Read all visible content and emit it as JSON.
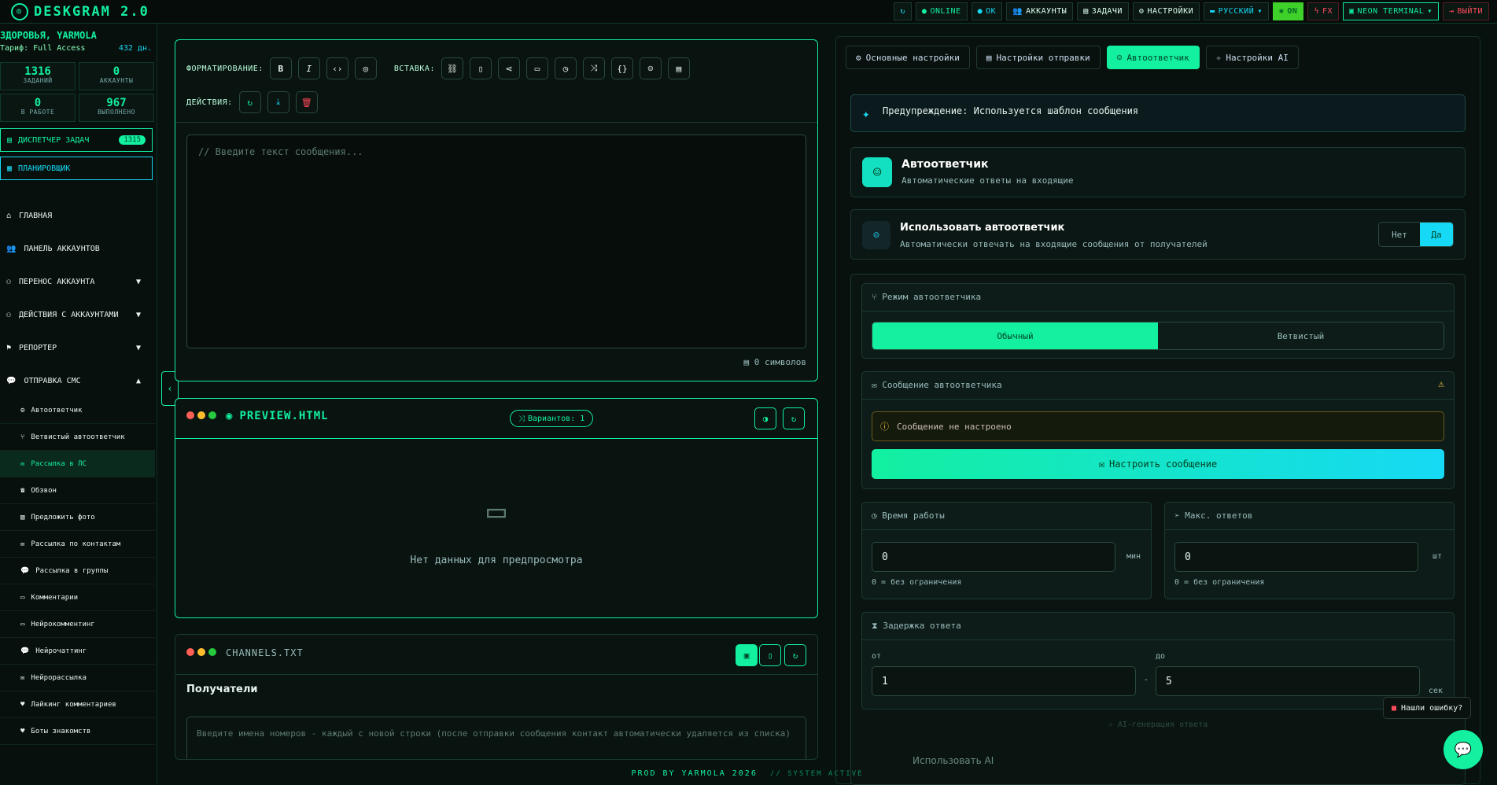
{
  "app": {
    "title": "DESKGRAM 2.0"
  },
  "topbar": {
    "online": "ONLINE",
    "ok": "OK",
    "accounts": "АККАУНТЫ",
    "tasks": "ЗАДАЧИ",
    "settings": "НАСТРОЙКИ",
    "language": "РУССКИЙ",
    "on": "ON",
    "fx": "FX",
    "neon": "NEON TERMINAL",
    "logout": "ВЫЙТИ"
  },
  "sidebar": {
    "user": "ЗДОРОВЬЯ, YARMOLA",
    "tariff": "Тариф: Full Access",
    "days": "432 дн.",
    "stats": [
      {
        "n": "1316",
        "l": "ЗАДАНИЙ"
      },
      {
        "n": "0",
        "l": "АККАУНТЫ"
      },
      {
        "n": "0",
        "l": "В РАБОТЕ"
      },
      {
        "n": "967",
        "l": "ВЫПОЛНЕНО"
      }
    ],
    "dispatcher": "ДИСПЕТЧЕР ЗАДАЧ",
    "dispatcher_badge": "1315",
    "scheduler": "ПЛАНИРОВЩИК",
    "nav": [
      {
        "label": "ГЛАВНАЯ"
      },
      {
        "label": "ПАНЕЛЬ АККАУНТОВ"
      },
      {
        "label": "ПЕРЕНОС АККАУНТА"
      },
      {
        "label": "ДЕЙСТВИЯ С АККАУНТАМИ"
      },
      {
        "label": "РЕПОРТЕР"
      },
      {
        "label": "ОТПРАВКА СМС"
      }
    ],
    "sub": [
      "Автоответчик",
      "Ветвистый автоответчик",
      "Рассылка в ЛС",
      "Обзвон",
      "Предложить фото",
      "Рассылка по контактам",
      "Рассылка в группы",
      "Комментарии",
      "Нейрокомментинг",
      "Нейрочаттинг",
      "Нейрорассылка",
      "Лайкинг комментариев",
      "Боты знакомств"
    ]
  },
  "editor": {
    "format_label": "ФОРМАТИРОВАНИЕ:",
    "insert_label": "ВСТАВКА:",
    "actions_label": "ДЕЙСТВИЯ:",
    "placeholder": "// Введите текст сообщения...",
    "chars": "0 символов"
  },
  "preview": {
    "title": "PREVIEW.HTML",
    "variants": "Вариантов: 1",
    "empty": "Нет данных для предпросмотра"
  },
  "channels": {
    "title": "CHANNELS.TXT",
    "recipients": "Получатели",
    "placeholder": "Введите имена номеров - каждый с новой строки (после отправки сообщения контакт автоматически удаляется из списка)"
  },
  "right": {
    "tabs": [
      "Основные настройки",
      "Настройки отправки",
      "Автоответчик",
      "Настройки AI"
    ],
    "warning": "Предупреждение: Используется шаблон сообщения",
    "auto_title": "Автоответчик",
    "auto_sub": "Автоматические ответы на входящие",
    "use_title": "Использовать автоответчик",
    "use_sub": "Автоматически отвечать на входящие сообщения от получателей",
    "no": "Нет",
    "yes": "Да",
    "mode_title": "Режим автоответчика",
    "mode_normal": "Обычный",
    "mode_branch": "Ветвистый",
    "msg_title": "Сообщение автоответчика",
    "msg_warn": "Сообщение не настроено",
    "msg_btn": "Настроить сообщение",
    "work_title": "Время работы",
    "work_val": "0",
    "work_unit": "мин",
    "work_hint": "0 = без ограничения",
    "max_title": "Макс. ответов",
    "max_val": "0",
    "max_unit": "шт",
    "max_hint": "0 = без ограничения",
    "delay_title": "Задержка ответа",
    "from": "от",
    "to": "до",
    "from_val": "1",
    "to_val": "5",
    "sec": "сек",
    "gen": "AI-генерация ответа",
    "use_ai": "Использовать AI"
  },
  "bug": "Нашли ошибку?",
  "footer": {
    "prod": "PROD BY YARMOLA 2026",
    "sys": "// SYSTEM ACTIVE"
  }
}
